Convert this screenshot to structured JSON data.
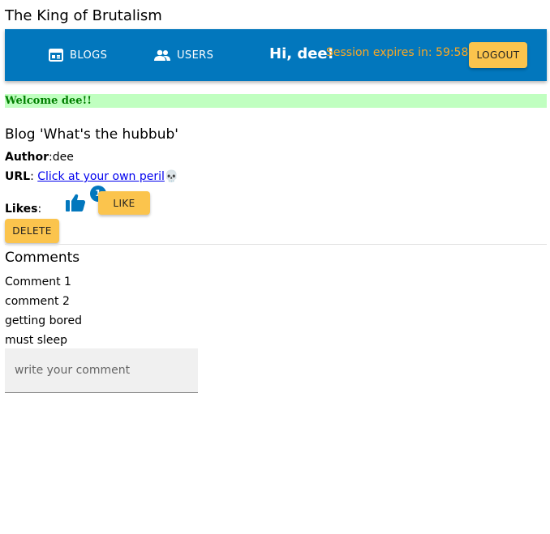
{
  "app": {
    "title": "The King of Brutalism"
  },
  "nav": {
    "blogs_label": "BLOGS",
    "users_label": "USERS",
    "greeting": "Hi, dee!",
    "session_text": "Session expires in: 59:58",
    "logout_label": "LOGOUT"
  },
  "notification": {
    "text": "Welcome dee!!"
  },
  "blog": {
    "title": "Blog 'What's the hubbub'",
    "author_label": "Author",
    "author": "dee",
    "url_label": "URL",
    "url_text": "Click at your own peril",
    "url_emoji": "💀",
    "likes_label": "Likes",
    "likes_count": "1",
    "like_button": "LIKE",
    "delete_button": "DELETE"
  },
  "comments": {
    "title": "Comments",
    "items": [
      "Comment 1",
      "comment 2",
      "getting bored",
      "must sleep"
    ],
    "input_placeholder": "write your comment"
  },
  "colors": {
    "navbar": "#0277bd",
    "accent_button": "#fbc44d",
    "session_text": "#f9a825",
    "notification_bg": "#c0ffc0",
    "notification_text": "#008000"
  }
}
